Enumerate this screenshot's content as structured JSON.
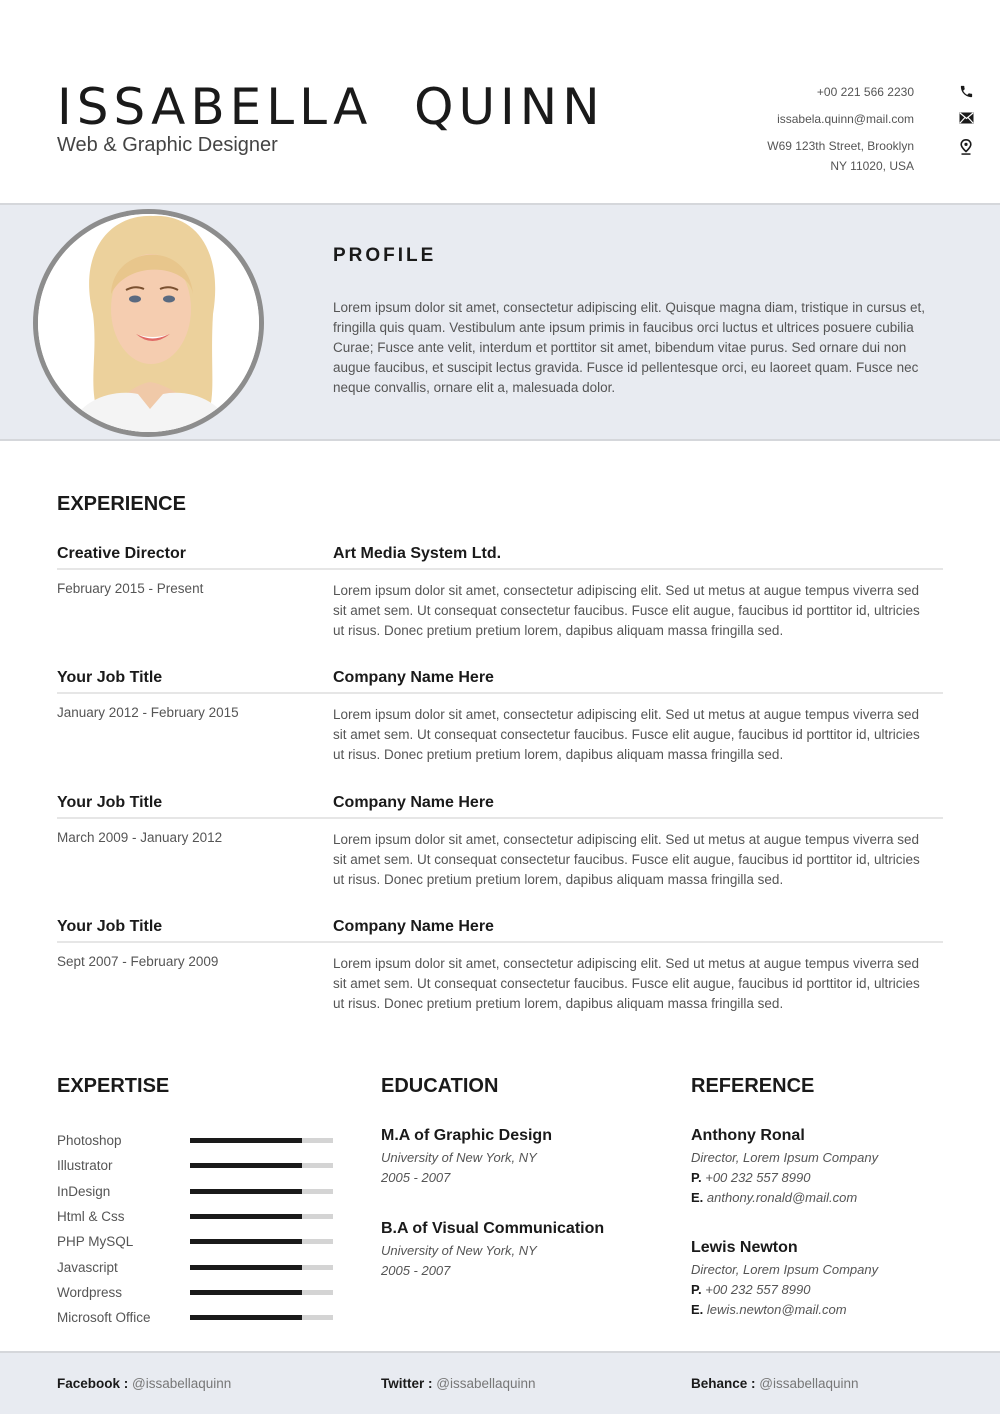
{
  "header": {
    "name": "ISSABELLA  QUINN",
    "title": "Web & Graphic Designer"
  },
  "contact": {
    "phone": "+00 221 566 2230",
    "email": "issabela.quinn@mail.com",
    "address_line1": "W69 123th Street, Brooklyn",
    "address_line2": "NY 11020, USA",
    "icons": [
      "phone-icon",
      "envelope-icon",
      "map-pin-icon"
    ]
  },
  "profile": {
    "heading": "PROFILE",
    "text": "Lorem ipsum dolor sit amet, consectetur adipiscing elit. Quisque magna diam, tristique in cursus et, fringilla quis quam. Vestibulum ante ipsum primis in faucibus orci luctus et ultrices posuere cubilia Curae; Fusce ante velit, interdum et porttitor sit amet, bibendum vitae purus. Sed ornare dui non augue faucibus, et suscipit lectus gravida. Fusce id pellentesque orci, eu laoreet quam. Fusce nec neque convallis, ornare elit a, malesuada dolor."
  },
  "experience": {
    "heading": "EXPERIENCE",
    "items": [
      {
        "title": "Creative Director",
        "company": "Art Media System Ltd.",
        "dates": "February 2015 - Present",
        "description": "Lorem ipsum dolor sit amet, consectetur adipiscing elit. Sed ut metus at augue tempus viverra sed sit amet sem. Ut consequat consectetur faucibus. Fusce elit augue, faucibus id porttitor id, ultricies ut risus. Donec pretium pretium lorem, dapibus aliquam massa fringilla sed."
      },
      {
        "title": "Your Job Title",
        "company": "Company Name Here",
        "dates": "January 2012 - February 2015",
        "description": "Lorem ipsum dolor sit amet, consectetur adipiscing elit. Sed ut metus at augue tempus viverra sed sit amet sem. Ut consequat consectetur faucibus. Fusce elit augue, faucibus id porttitor id, ultricies ut risus. Donec pretium pretium lorem, dapibus aliquam massa fringilla sed."
      },
      {
        "title": "Your Job Title",
        "company": "Company Name Here",
        "dates": "March 2009 - January 2012",
        "description": "Lorem ipsum dolor sit amet, consectetur adipiscing elit. Sed ut metus at augue tempus viverra sed sit amet sem. Ut consequat consectetur faucibus. Fusce elit augue, faucibus id porttitor id, ultricies ut risus. Donec pretium pretium lorem, dapibus aliquam massa fringilla sed."
      },
      {
        "title": "Your Job Title",
        "company": "Company Name Here",
        "dates": "Sept 2007 - February 2009",
        "description": "Lorem ipsum dolor sit amet, consectetur adipiscing elit. Sed ut metus at augue tempus viverra sed sit amet sem. Ut consequat consectetur faucibus. Fusce elit augue, faucibus id porttitor id, ultricies ut risus. Donec pretium pretium lorem, dapibus aliquam massa fringilla sed."
      }
    ]
  },
  "expertise": {
    "heading": "EXPERTISE",
    "skills": [
      {
        "name": "Photoshop",
        "level": 0.78
      },
      {
        "name": "Illustrator",
        "level": 0.78
      },
      {
        "name": "InDesign",
        "level": 0.78
      },
      {
        "name": "Html & Css",
        "level": 0.78
      },
      {
        "name": "PHP MySQL",
        "level": 0.78
      },
      {
        "name": "Javascript",
        "level": 0.78
      },
      {
        "name": "Wordpress",
        "level": 0.78
      },
      {
        "name": "Microsoft Office",
        "level": 0.78
      }
    ]
  },
  "education": {
    "heading": "EDUCATION",
    "items": [
      {
        "degree": "M.A of Graphic Design",
        "school": "University of New York, NY",
        "years": "2005 - 2007"
      },
      {
        "degree": "B.A of Visual Communication",
        "school": "University of New York, NY",
        "years": "2005 - 2007"
      }
    ]
  },
  "reference": {
    "heading": "REFERENCE",
    "phone_label": "P.",
    "email_label": "E.",
    "items": [
      {
        "name": "Anthony Ronal",
        "role": "Director, Lorem Ipsum Company",
        "phone": "+00 232 557 8990",
        "email": "anthony.ronald@mail.com"
      },
      {
        "name": "Lewis Newton",
        "role": "Director, Lorem Ipsum Company",
        "phone": "+00 232 557 8990",
        "email": "lewis.newton@mail.com"
      }
    ]
  },
  "footer": {
    "social": [
      {
        "label": "Facebook :",
        "handle": "@issabellaquinn"
      },
      {
        "label": "Twitter :",
        "handle": "@issabellaquinn"
      },
      {
        "label": "Behance :",
        "handle": "@issabellaquinn"
      }
    ]
  },
  "colors": {
    "band": "#e8ebf1",
    "text_dark": "#1a1a1a",
    "text_muted": "#555555",
    "skill_fill": "#1a1a1a",
    "skill_track": "#d4d4d4"
  }
}
